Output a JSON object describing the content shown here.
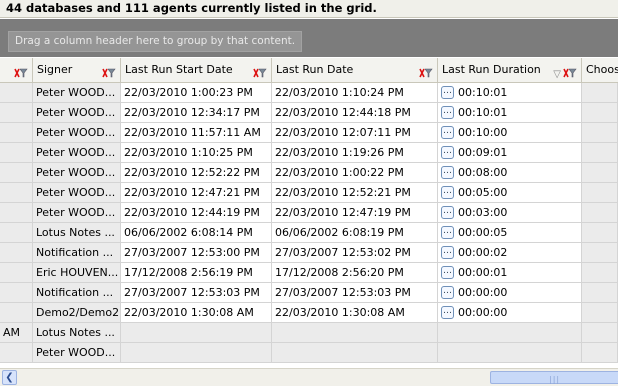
{
  "status": {
    "text": "44 databases and 111 agents currently listed in the grid."
  },
  "group_panel": {
    "hint": "Drag a column header here to group by that content."
  },
  "columns": {
    "signer": "Signer",
    "last_run_start_date": "Last Run Start Date",
    "last_run_date": "Last Run Date",
    "last_run_duration": "Last Run Duration",
    "choose": "Choos"
  },
  "rows": [
    {
      "left": "",
      "signer": "Peter WOOD...",
      "start": "22/03/2010 1:00:23 PM",
      "last_run": "22/03/2010 1:10:24 PM",
      "duration": "00:10:01"
    },
    {
      "left": "",
      "signer": "Peter WOOD...",
      "start": "22/03/2010 12:34:17 PM",
      "last_run": "22/03/2010 12:44:18 PM",
      "duration": "00:10:01"
    },
    {
      "left": "",
      "signer": "Peter WOOD...",
      "start": "22/03/2010 11:57:11 AM",
      "last_run": "22/03/2010 12:07:11 PM",
      "duration": "00:10:00"
    },
    {
      "left": "",
      "signer": "Peter WOOD...",
      "start": "22/03/2010 1:10:25 PM",
      "last_run": "22/03/2010 1:19:26 PM",
      "duration": "00:09:01"
    },
    {
      "left": "",
      "signer": "Peter WOOD...",
      "start": "22/03/2010 12:52:22 PM",
      "last_run": "22/03/2010 1:00:22 PM",
      "duration": "00:08:00"
    },
    {
      "left": "",
      "signer": "Peter WOOD...",
      "start": "22/03/2010 12:47:21 PM",
      "last_run": "22/03/2010 12:52:21 PM",
      "duration": "00:05:00"
    },
    {
      "left": "",
      "signer": "Peter WOOD...",
      "start": "22/03/2010 12:44:19 PM",
      "last_run": "22/03/2010 12:47:19 PM",
      "duration": "00:03:00"
    },
    {
      "left": "",
      "signer": "Lotus Notes ...",
      "start": "06/06/2002 6:08:14 PM",
      "last_run": "06/06/2002 6:08:19 PM",
      "duration": "00:00:05"
    },
    {
      "left": "",
      "signer": "Notification ...",
      "start": "27/03/2007 12:53:00 PM",
      "last_run": "27/03/2007 12:53:02 PM",
      "duration": "00:00:02"
    },
    {
      "left": "",
      "signer": "Eric HOUVEN...",
      "start": "17/12/2008 2:56:19 PM",
      "last_run": "17/12/2008 2:56:20 PM",
      "duration": "00:00:01"
    },
    {
      "left": "",
      "signer": "Notification ...",
      "start": "27/03/2007 12:53:03 PM",
      "last_run": "27/03/2007 12:53:03 PM",
      "duration": "00:00:00"
    },
    {
      "left": "",
      "signer": "Demo2/Demo2",
      "start": "22/03/2010 1:30:08 AM",
      "last_run": "22/03/2010 1:30:08 AM",
      "duration": "00:00:00"
    },
    {
      "left": "AM",
      "signer": "Lotus Notes ...",
      "start": "",
      "last_run": "",
      "duration": ""
    },
    {
      "left": "",
      "signer": "Peter WOOD...",
      "start": "",
      "last_run": "",
      "duration": ""
    }
  ],
  "icons": {
    "filter": "filter-clear-icon",
    "ellipsis": "ellipsis-button-icon",
    "sort": "sort-down-icon",
    "scroll_left": "scroll-left-arrow-icon"
  }
}
